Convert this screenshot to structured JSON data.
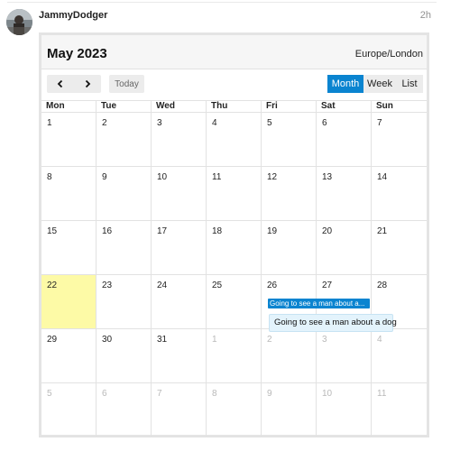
{
  "post": {
    "username": "JammyDodger",
    "time_ago": "2h"
  },
  "calendar": {
    "title": "May 2023",
    "timezone": "Europe/London",
    "nav": {
      "prev_icon": "chevron-left-icon",
      "next_icon": "chevron-right-icon"
    },
    "today_label": "Today",
    "views": {
      "month": "Month",
      "week": "Week",
      "list": "List"
    },
    "active_view": "Month",
    "accent_color": "#0a84d0",
    "today_highlight_color": "#fdfaa6",
    "days_of_week": [
      "Mon",
      "Tue",
      "Wed",
      "Thu",
      "Fri",
      "Sat",
      "Sun"
    ],
    "weeks": [
      [
        "1",
        "2",
        "3",
        "4",
        "5",
        "6",
        "7"
      ],
      [
        "8",
        "9",
        "10",
        "11",
        "12",
        "13",
        "14"
      ],
      [
        "15",
        "16",
        "17",
        "18",
        "19",
        "20",
        "21"
      ],
      [
        "22",
        "23",
        "24",
        "25",
        "26",
        "27",
        "28"
      ],
      [
        "29",
        "30",
        "31",
        "1",
        "2",
        "3",
        "4"
      ],
      [
        "5",
        "6",
        "7",
        "8",
        "9",
        "10",
        "11"
      ]
    ],
    "today_date": "22",
    "event": {
      "short_label": "Going to see a man about a...",
      "tooltip": "Going to see a man about a dog"
    }
  }
}
